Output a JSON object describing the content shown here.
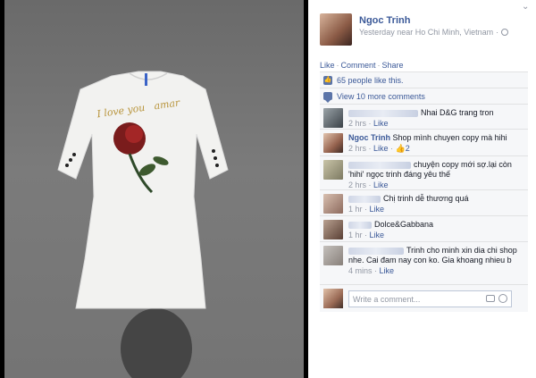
{
  "photo": {
    "garment_text": "I love you   amar"
  },
  "post": {
    "owner_name": "Ngoc Trinh",
    "meta": "Yesterday near Ho Chi Minh, Vietnam",
    "meta_sep": "·",
    "actions": {
      "like": "Like",
      "comment": "Comment",
      "share": "Share",
      "sep": "·"
    }
  },
  "ufi": {
    "likes_text": "65 people like this.",
    "view_more": "View 10 more comments",
    "comments": [
      {
        "name": "",
        "text": "Nhai D&G trang tron",
        "time": "2 hrs",
        "like": "Like"
      },
      {
        "name": "Ngoc Trinh",
        "text": "Shop mình chuyen copy mà hihi",
        "time": "2 hrs",
        "like": "Like",
        "likes_count": "2"
      },
      {
        "name": "",
        "text": "chuyện copy mới sợ.lại còn 'hihi' ngọc trinh đáng yêu thế",
        "time": "2 hrs",
        "like": "Like"
      },
      {
        "name": "",
        "text": "Chị trinh dễ thương quá",
        "time": "1 hr",
        "like": "Like"
      },
      {
        "name": "",
        "text": "Dolce&Gabbana",
        "time": "1 hr",
        "like": "Like"
      },
      {
        "name": "",
        "text": "Trinh cho minh xin dia chi shop nhe. Cai đam nay con ko. Gia khoang nhieu b",
        "time": "4 mins",
        "like": "Like"
      }
    ],
    "write_placeholder": "Write a comment..."
  },
  "colors": {
    "link": "#3b5998",
    "muted": "#9197a3",
    "ufi_bg": "#f6f7f9"
  }
}
